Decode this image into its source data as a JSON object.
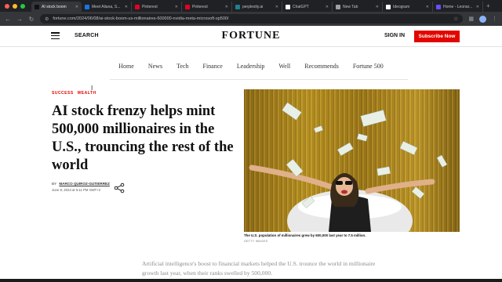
{
  "browser": {
    "tabs": [
      {
        "label": "AI stock boom",
        "favicon_color": "#111111",
        "active": true
      },
      {
        "label": "Meet Aliana, S...",
        "favicon_color": "#1a73e8",
        "active": false
      },
      {
        "label": "Pinterest",
        "favicon_color": "#e60023",
        "active": false
      },
      {
        "label": "Pinterest",
        "favicon_color": "#e60023",
        "active": false
      },
      {
        "label": "perplexity.ai",
        "favicon_color": "#20808d",
        "active": false
      },
      {
        "label": "ChatGPT",
        "favicon_color": "#ffffff",
        "active": false
      },
      {
        "label": "New Tab",
        "favicon_color": "#9aa0a6",
        "active": false
      },
      {
        "label": "Ideogram",
        "favicon_color": "#ffffff",
        "active": false
      },
      {
        "label": "Home - Leonar...",
        "favicon_color": "#6b4cff",
        "active": false
      }
    ],
    "url": "fortune.com/2024/06/08/ai-stock-boom-us-millionaires-600000-nvidia-meta-microsoft-sp500/"
  },
  "header": {
    "search_label": "SEARCH",
    "logo": "FORTUNE",
    "signin_label": "SIGN IN",
    "subscribe_label": "Subscribe Now"
  },
  "nav": {
    "items": [
      "Home",
      "News",
      "Tech",
      "Finance",
      "Leadership",
      "Well",
      "Recommends",
      "Fortune 500"
    ]
  },
  "article": {
    "kicker": [
      "SUCCESS",
      "WEALTH"
    ],
    "headline": "AI stock frenzy helps mint 500,000 millionaires in the U.S., trouncing the rest of the world",
    "byline_prefix": "BY",
    "author": "MARCO QUIROZ-GUTIERREZ",
    "date": "June 8, 2024 at 6:11 PM GMT+2",
    "image_caption": "The U.S. population of millionaires grew by 600,000 last year to 7.5 million.",
    "image_credit": "GETTY IMAGES",
    "body_preview": "Artificial intelligence's boost to financial markets helped the U.S. trounce the world in millionaire growth last year, when their ranks swelled by 500,000."
  },
  "colors": {
    "brand_red": "#e10600",
    "chrome_dark": "#202124"
  }
}
